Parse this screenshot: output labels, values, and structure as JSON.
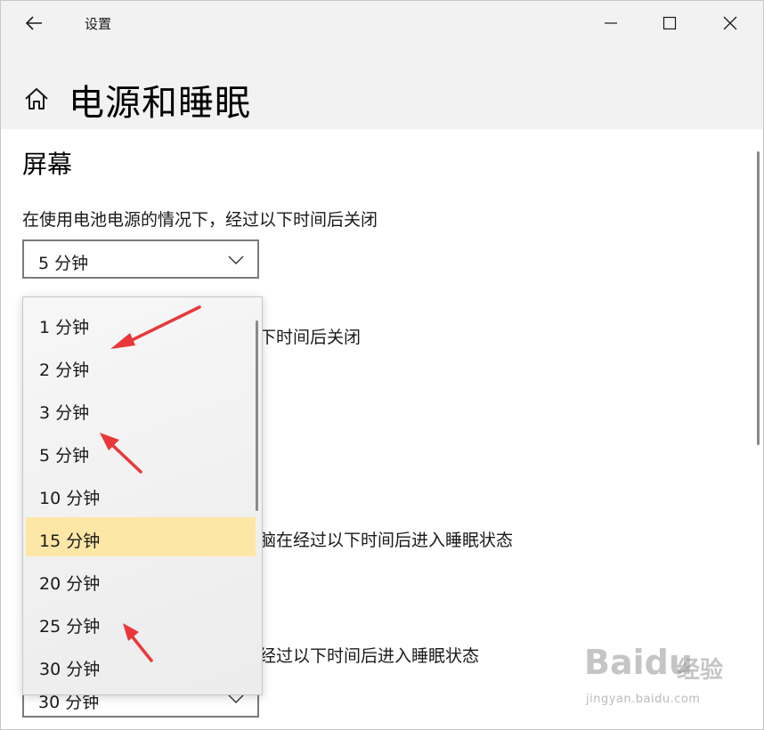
{
  "titlebar": {
    "title": "设置",
    "back_icon": "back-arrow-icon",
    "minimize_icon": "minimize-icon",
    "maximize_icon": "maximize-icon",
    "close_icon": "close-icon"
  },
  "header": {
    "home_icon": "home-icon",
    "title": "电源和睡眠"
  },
  "screen_section": {
    "title": "屏幕",
    "battery_label": "在使用电池电源的情况下，经过以下时间后关闭",
    "battery_value": "5 分钟",
    "plugged_label_visible": "下时间后关闭"
  },
  "sleep_section": {
    "battery_label_visible": "脑在经过以下时间后进入睡眠状态",
    "plugged_label_visible": "经过以下时间后进入睡眠状态",
    "plugged_value": "30 分钟"
  },
  "dropdown": {
    "options": [
      "1 分钟",
      "2 分钟",
      "3 分钟",
      "5 分钟",
      "10 分钟",
      "15 分钟",
      "20 分钟",
      "25 分钟",
      "30 分钟"
    ],
    "highlighted": "15 分钟"
  },
  "colors": {
    "chrome_bg": "#f2f2f2",
    "highlight": "#fee7a6",
    "annotation_arrow": "#e8383b",
    "border": "#7a7a7a"
  },
  "watermark": {
    "brand": "Baidu",
    "brand_cn": "经验",
    "url": "jingyan.baidu.com"
  }
}
